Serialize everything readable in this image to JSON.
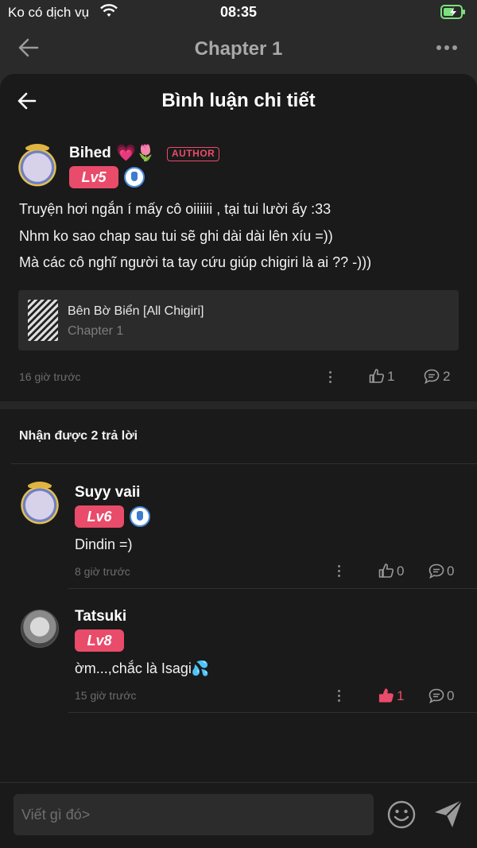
{
  "status": {
    "carrier": "Ko có dịch vụ",
    "time": "08:35"
  },
  "nav": {
    "title": "Chapter 1"
  },
  "sheet": {
    "title": "Bình luận chi tiết"
  },
  "main_comment": {
    "user": "Bihed",
    "emojis": "💗🌷",
    "author_tag": "AUTHOR",
    "level": "Lv5",
    "lines": [
      "Truyện hơi ngắn í mấy cô oiiiiii , tại tui lười ấy :33",
      "Nhm ko sao chap sau tui sẽ ghi dài dài lên xíu =))",
      "Mà các cô nghĩ người ta tay cứu giúp chigiri là ai ?? -)))"
    ],
    "story_title": "Bên Bờ Biển [All Chigiri]",
    "chapter": "Chapter 1",
    "time": "16 giờ trước",
    "likes": "1",
    "replies": "2"
  },
  "replies_title": "Nhận được 2 trả lời",
  "replies": [
    {
      "user": "Suyy vaii",
      "level": "Lv6",
      "text": "Dindin =)",
      "time": "8 giờ trước",
      "likes": "0",
      "comments": "0"
    },
    {
      "user": "Tatsuki",
      "level": "Lv8",
      "text": "ờm...,chắc là Isagi💦",
      "time": "15 giờ trước",
      "likes": "1",
      "comments": "0"
    }
  ],
  "input": {
    "placeholder": "Viết gì đó>"
  },
  "colors": {
    "accent": "#e94b6a",
    "sheet_bg": "#1a1a1a",
    "backdrop": "#2a2a2a"
  }
}
